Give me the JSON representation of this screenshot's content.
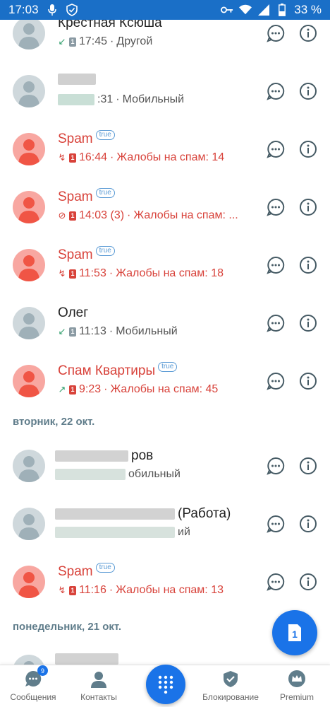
{
  "status_bar": {
    "time": "17:03",
    "battery": "33 %"
  },
  "calls": [
    {
      "name": "Крестная Ксюша",
      "time": "17:45",
      "separator": " · ",
      "type": "Другой",
      "spam": false,
      "call": "incoming"
    },
    {
      "name": "",
      "time": ":31",
      "separator": " · ",
      "type": "Мобильный",
      "spam": false,
      "call": "none"
    },
    {
      "name": "Spam",
      "badge": "true",
      "time": "16:44",
      "separator": " · ",
      "type": "Жалобы на спам: 14",
      "spam": true,
      "call": "missed"
    },
    {
      "name": "Spam",
      "badge": "true",
      "time": "14:03 (3)",
      "separator": " · ",
      "type": "Жалобы на спам: ...",
      "spam": true,
      "call": "blocked"
    },
    {
      "name": "Spam",
      "badge": "true",
      "time": "11:53",
      "separator": " · ",
      "type": "Жалобы на спам: 18",
      "spam": true,
      "call": "missed"
    },
    {
      "name": "Олег",
      "time": "11:13",
      "separator": " · ",
      "type": "Мобильный",
      "spam": false,
      "call": "incoming"
    },
    {
      "name": "Спам Квартиры",
      "badge": "true",
      "time": "9:23",
      "separator": " · ",
      "type": "Жалобы на спам: 45",
      "spam": true,
      "call": "outgoing"
    }
  ],
  "section_tuesday": "вторник, 22 окт.",
  "calls2": [
    {
      "name": "ров",
      "type": "обильный",
      "spam": false
    },
    {
      "name": "(Работа)",
      "type": "ий",
      "spam": false
    },
    {
      "name": "Spam",
      "badge": "true",
      "time": "11:16",
      "separator": " · ",
      "type": "Жалобы на спам: 13",
      "spam": true,
      "call": "missed"
    }
  ],
  "section_monday": "понедельник, 21 окт.",
  "nav": {
    "messages": "Сообщения",
    "messages_badge": "9",
    "contacts": "Контакты",
    "blocking": "Блокирование",
    "premium": "Premium"
  },
  "colors": {
    "brand": "#1a73e8",
    "spam": "#d8423a",
    "muted": "#607d8b"
  }
}
